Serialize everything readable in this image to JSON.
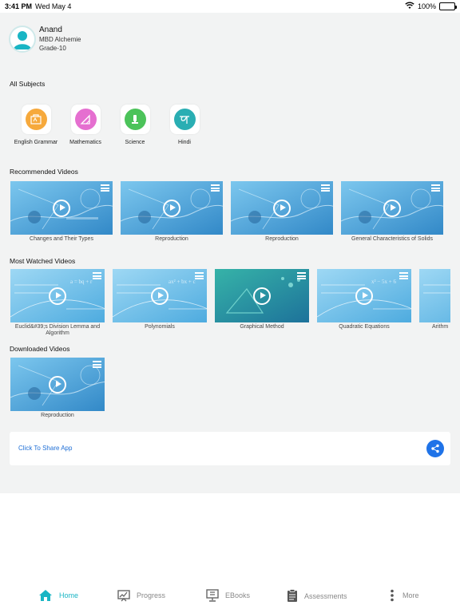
{
  "status_bar": {
    "time": "3:41 PM",
    "date": "Wed May 4",
    "battery": "100%"
  },
  "profile": {
    "name": "Anand",
    "school": "MBD Alchemie",
    "grade": "Grade-10"
  },
  "sections": {
    "subjects": "All Subjects",
    "recommended": "Recommended Videos",
    "most_watched": "Most Watched Videos",
    "downloaded": "Downloaded Videos"
  },
  "subjects": [
    {
      "label": "English Grammar",
      "color": "#f6a93c",
      "icon": "english-grammar-icon"
    },
    {
      "label": "Mathematics",
      "color": "#e56fd0",
      "icon": "mathematics-icon"
    },
    {
      "label": "Science",
      "color": "#4cc35a",
      "icon": "science-icon"
    },
    {
      "label": "Hindi",
      "color": "#2aaeb3",
      "icon": "hindi-icon"
    }
  ],
  "recommended_videos": [
    "Changes and Their Types",
    "Reproduction",
    "Reproduction",
    "General Characteristics of Solids"
  ],
  "most_watched_videos": [
    "Euclid&#39;s Division Lemma and Algorithm",
    "Polynomials",
    "Graphical Method",
    "Quadratic Equations",
    "Arithm"
  ],
  "downloaded_videos": [
    "Reproduction"
  ],
  "share": {
    "label": "Click To Share App"
  },
  "tabs": [
    {
      "label": "Home",
      "active": true
    },
    {
      "label": "Progress",
      "active": false
    },
    {
      "label": "EBooks",
      "active": false
    },
    {
      "label": "Assessments",
      "active": false
    },
    {
      "label": "More",
      "active": false
    }
  ],
  "colors": {
    "accent": "#19b5c4",
    "link": "#1f6fd6",
    "share_button": "#1f73e8",
    "thumbnail": "#3b9fd8"
  }
}
